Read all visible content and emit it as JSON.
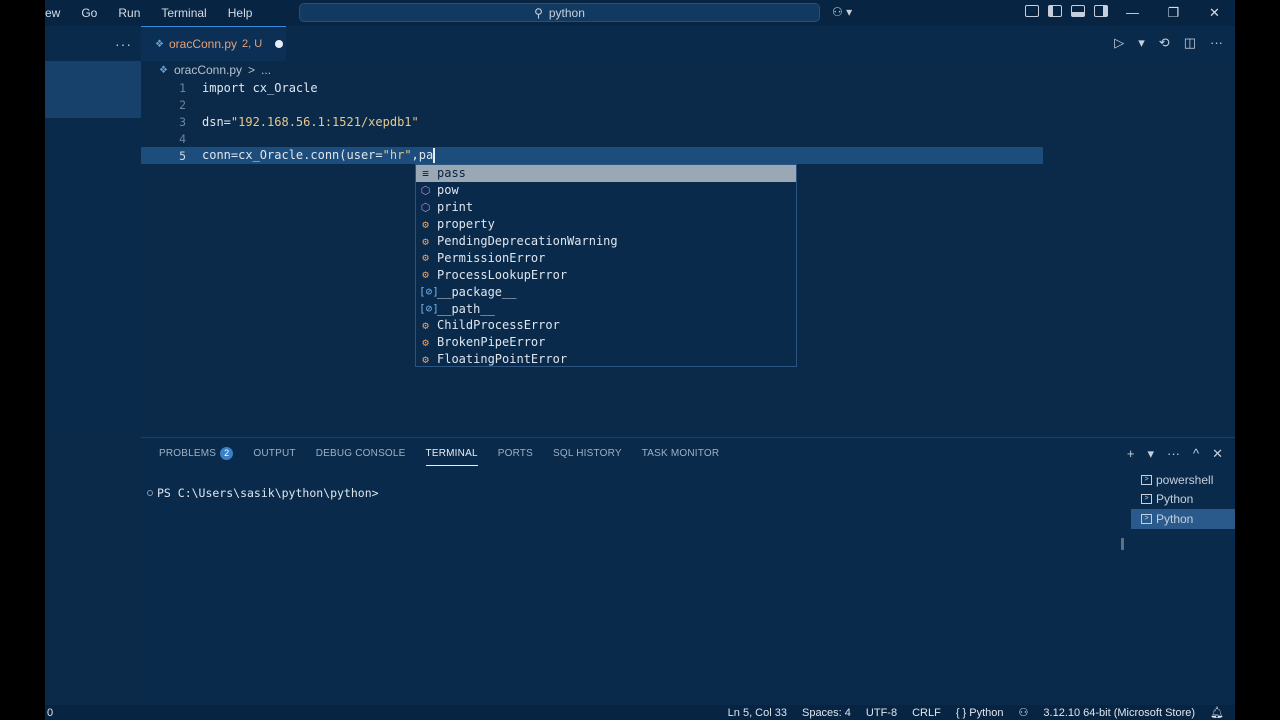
{
  "menu": [
    "ew",
    "Go",
    "Run",
    "Terminal",
    "Help"
  ],
  "nav": {
    "back": "←",
    "forward": "→"
  },
  "command_center": {
    "icon": "⚲",
    "text": "python"
  },
  "copilot": {
    "text": "⚇ ▾"
  },
  "window_controls": {
    "minimize": "—",
    "restore": "❐",
    "close": "✕"
  },
  "sidebar": {
    "more": "···"
  },
  "tab": {
    "icon": "❖",
    "label": "oracConn.py",
    "status": "2, U"
  },
  "editor_actions": {
    "run": "▷",
    "run_menu": "▾",
    "compare": "⟲",
    "split": "◫",
    "more": "···"
  },
  "breadcrumb": {
    "file": "oracConn.py",
    "sep": ">",
    "rest": "..."
  },
  "code": {
    "lines": [
      {
        "num": "1",
        "text": "import cx_Oracle"
      },
      {
        "num": "2",
        "text": ""
      },
      {
        "num": "3",
        "pre": "dsn=",
        "str": "\"192.168.56.1:1521/xepdb1\""
      },
      {
        "num": "4",
        "text": ""
      },
      {
        "num": "5",
        "pre": "conn=cx_Oracle.conn",
        "mid": "(user=",
        "str": "\"hr\"",
        "post": ",pa"
      }
    ]
  },
  "suggestions": [
    {
      "label": "pass",
      "kind": "keyword",
      "icon": "≡"
    },
    {
      "label": "pow",
      "kind": "function",
      "icon": "⬡"
    },
    {
      "label": "print",
      "kind": "function",
      "icon": "⬡"
    },
    {
      "label": "property",
      "kind": "class",
      "icon": "⚙"
    },
    {
      "label": "PendingDeprecationWarning",
      "kind": "class",
      "icon": "⚙"
    },
    {
      "label": "PermissionError",
      "kind": "class",
      "icon": "⚙"
    },
    {
      "label": "ProcessLookupError",
      "kind": "class",
      "icon": "⚙"
    },
    {
      "label": "__package__",
      "kind": "variable",
      "icon": "[⊘]"
    },
    {
      "label": "__path__",
      "kind": "variable",
      "icon": "[⊘]"
    },
    {
      "label": "ChildProcessError",
      "kind": "class",
      "icon": "⚙"
    },
    {
      "label": "BrokenPipeError",
      "kind": "class",
      "icon": "⚙"
    },
    {
      "label": "FloatingPointError",
      "kind": "class",
      "icon": "⚙"
    }
  ],
  "panel": {
    "tabs": [
      "PROBLEMS",
      "OUTPUT",
      "DEBUG CONSOLE",
      "TERMINAL",
      "PORTS",
      "SQL HISTORY",
      "TASK MONITOR"
    ],
    "active_tab": "TERMINAL",
    "problems_count": "2",
    "actions": {
      "new": "+",
      "new_menu": "▾",
      "more": "···",
      "maximize": "^",
      "close": "✕"
    },
    "prompt": "PS C:\\Users\\sasik\\python\\python>",
    "terminals": [
      {
        "label": "powershell",
        "selected": false
      },
      {
        "label": "Python",
        "selected": false
      },
      {
        "label": "Python",
        "selected": true
      }
    ]
  },
  "status": {
    "left": "0",
    "position": "Ln 5, Col 33",
    "spaces": "Spaces: 4",
    "encoding": "UTF-8",
    "eol": "CRLF",
    "language": "{ } Python",
    "copilot_icon": "⚇",
    "interpreter": "3.12.10 64-bit (Microsoft Store)",
    "bell": "🔔︎"
  }
}
